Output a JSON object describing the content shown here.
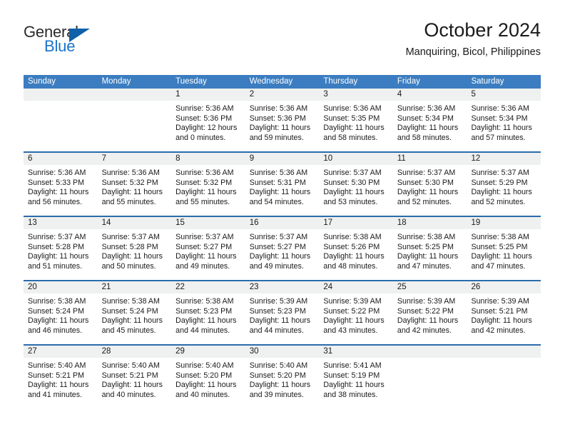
{
  "logo": {
    "word1": "General",
    "word2": "Blue",
    "triangle_icon": "triangle-icon",
    "blue": "#1874c8",
    "dark": "#2b2b2b"
  },
  "header": {
    "title": "October 2024",
    "subtitle": "Manquiring, Bicol, Philippines"
  },
  "theme": {
    "header_blue": "#3b7dc0",
    "separator_blue": "#2b6cad",
    "day_band_gray": "#eff0f0"
  },
  "weekdays": [
    "Sunday",
    "Monday",
    "Tuesday",
    "Wednesday",
    "Thursday",
    "Friday",
    "Saturday"
  ],
  "weeks": [
    [
      {
        "day": "",
        "lines": []
      },
      {
        "day": "",
        "lines": []
      },
      {
        "day": "1",
        "lines": [
          "Sunrise: 5:36 AM",
          "Sunset: 5:36 PM",
          "Daylight: 12 hours",
          "and 0 minutes."
        ]
      },
      {
        "day": "2",
        "lines": [
          "Sunrise: 5:36 AM",
          "Sunset: 5:36 PM",
          "Daylight: 11 hours",
          "and 59 minutes."
        ]
      },
      {
        "day": "3",
        "lines": [
          "Sunrise: 5:36 AM",
          "Sunset: 5:35 PM",
          "Daylight: 11 hours",
          "and 58 minutes."
        ]
      },
      {
        "day": "4",
        "lines": [
          "Sunrise: 5:36 AM",
          "Sunset: 5:34 PM",
          "Daylight: 11 hours",
          "and 58 minutes."
        ]
      },
      {
        "day": "5",
        "lines": [
          "Sunrise: 5:36 AM",
          "Sunset: 5:34 PM",
          "Daylight: 11 hours",
          "and 57 minutes."
        ]
      }
    ],
    [
      {
        "day": "6",
        "lines": [
          "Sunrise: 5:36 AM",
          "Sunset: 5:33 PM",
          "Daylight: 11 hours",
          "and 56 minutes."
        ]
      },
      {
        "day": "7",
        "lines": [
          "Sunrise: 5:36 AM",
          "Sunset: 5:32 PM",
          "Daylight: 11 hours",
          "and 55 minutes."
        ]
      },
      {
        "day": "8",
        "lines": [
          "Sunrise: 5:36 AM",
          "Sunset: 5:32 PM",
          "Daylight: 11 hours",
          "and 55 minutes."
        ]
      },
      {
        "day": "9",
        "lines": [
          "Sunrise: 5:36 AM",
          "Sunset: 5:31 PM",
          "Daylight: 11 hours",
          "and 54 minutes."
        ]
      },
      {
        "day": "10",
        "lines": [
          "Sunrise: 5:37 AM",
          "Sunset: 5:30 PM",
          "Daylight: 11 hours",
          "and 53 minutes."
        ]
      },
      {
        "day": "11",
        "lines": [
          "Sunrise: 5:37 AM",
          "Sunset: 5:30 PM",
          "Daylight: 11 hours",
          "and 52 minutes."
        ]
      },
      {
        "day": "12",
        "lines": [
          "Sunrise: 5:37 AM",
          "Sunset: 5:29 PM",
          "Daylight: 11 hours",
          "and 52 minutes."
        ]
      }
    ],
    [
      {
        "day": "13",
        "lines": [
          "Sunrise: 5:37 AM",
          "Sunset: 5:28 PM",
          "Daylight: 11 hours",
          "and 51 minutes."
        ]
      },
      {
        "day": "14",
        "lines": [
          "Sunrise: 5:37 AM",
          "Sunset: 5:28 PM",
          "Daylight: 11 hours",
          "and 50 minutes."
        ]
      },
      {
        "day": "15",
        "lines": [
          "Sunrise: 5:37 AM",
          "Sunset: 5:27 PM",
          "Daylight: 11 hours",
          "and 49 minutes."
        ]
      },
      {
        "day": "16",
        "lines": [
          "Sunrise: 5:37 AM",
          "Sunset: 5:27 PM",
          "Daylight: 11 hours",
          "and 49 minutes."
        ]
      },
      {
        "day": "17",
        "lines": [
          "Sunrise: 5:38 AM",
          "Sunset: 5:26 PM",
          "Daylight: 11 hours",
          "and 48 minutes."
        ]
      },
      {
        "day": "18",
        "lines": [
          "Sunrise: 5:38 AM",
          "Sunset: 5:25 PM",
          "Daylight: 11 hours",
          "and 47 minutes."
        ]
      },
      {
        "day": "19",
        "lines": [
          "Sunrise: 5:38 AM",
          "Sunset: 5:25 PM",
          "Daylight: 11 hours",
          "and 47 minutes."
        ]
      }
    ],
    [
      {
        "day": "20",
        "lines": [
          "Sunrise: 5:38 AM",
          "Sunset: 5:24 PM",
          "Daylight: 11 hours",
          "and 46 minutes."
        ]
      },
      {
        "day": "21",
        "lines": [
          "Sunrise: 5:38 AM",
          "Sunset: 5:24 PM",
          "Daylight: 11 hours",
          "and 45 minutes."
        ]
      },
      {
        "day": "22",
        "lines": [
          "Sunrise: 5:38 AM",
          "Sunset: 5:23 PM",
          "Daylight: 11 hours",
          "and 44 minutes."
        ]
      },
      {
        "day": "23",
        "lines": [
          "Sunrise: 5:39 AM",
          "Sunset: 5:23 PM",
          "Daylight: 11 hours",
          "and 44 minutes."
        ]
      },
      {
        "day": "24",
        "lines": [
          "Sunrise: 5:39 AM",
          "Sunset: 5:22 PM",
          "Daylight: 11 hours",
          "and 43 minutes."
        ]
      },
      {
        "day": "25",
        "lines": [
          "Sunrise: 5:39 AM",
          "Sunset: 5:22 PM",
          "Daylight: 11 hours",
          "and 42 minutes."
        ]
      },
      {
        "day": "26",
        "lines": [
          "Sunrise: 5:39 AM",
          "Sunset: 5:21 PM",
          "Daylight: 11 hours",
          "and 42 minutes."
        ]
      }
    ],
    [
      {
        "day": "27",
        "lines": [
          "Sunrise: 5:40 AM",
          "Sunset: 5:21 PM",
          "Daylight: 11 hours",
          "and 41 minutes."
        ]
      },
      {
        "day": "28",
        "lines": [
          "Sunrise: 5:40 AM",
          "Sunset: 5:21 PM",
          "Daylight: 11 hours",
          "and 40 minutes."
        ]
      },
      {
        "day": "29",
        "lines": [
          "Sunrise: 5:40 AM",
          "Sunset: 5:20 PM",
          "Daylight: 11 hours",
          "and 40 minutes."
        ]
      },
      {
        "day": "30",
        "lines": [
          "Sunrise: 5:40 AM",
          "Sunset: 5:20 PM",
          "Daylight: 11 hours",
          "and 39 minutes."
        ]
      },
      {
        "day": "31",
        "lines": [
          "Sunrise: 5:41 AM",
          "Sunset: 5:19 PM",
          "Daylight: 11 hours",
          "and 38 minutes."
        ]
      },
      {
        "day": "",
        "lines": []
      },
      {
        "day": "",
        "lines": []
      }
    ]
  ]
}
